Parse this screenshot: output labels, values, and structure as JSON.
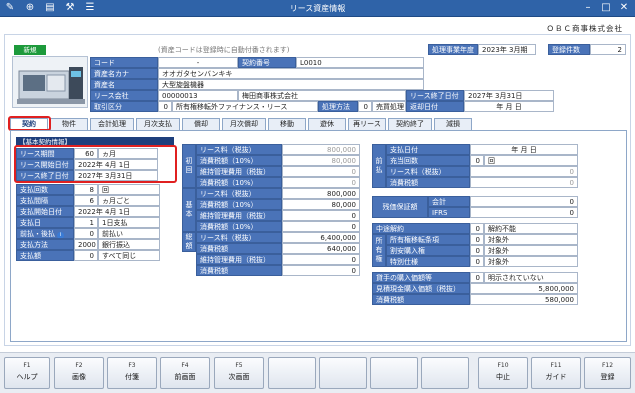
{
  "window": {
    "title": "リース資産情報",
    "company": "ＯＢＣ商事株式会社"
  },
  "header": {
    "new_badge": "新規",
    "code_hint": "(資産コードは登録時に自動付番されます)",
    "fiscal_year_label": "処理事業年度",
    "fiscal_year_value": "2023年 3月期",
    "reg_count_label": "登録件数",
    "reg_count_value": "2",
    "code_label": "コード",
    "code_value": "-",
    "contract_no_label": "契約番号",
    "contract_no_value": "L0010",
    "kana_label": "資産名カナ",
    "kana_value": "オオガタセンバンキキ",
    "name_label": "資産名",
    "name_value": "大型旋盤機器",
    "lease_co_label": "リース会社",
    "lease_co_code": "00000013",
    "lease_co_name": "梅田商事株式会社",
    "lease_end_label": "リース終了日付",
    "lease_end_value": "2027年 3月31日",
    "trade_label": "取引区分",
    "trade_code": "0",
    "trade_name": "所有権移転外ファイナンス・リース",
    "method_label": "処理方法",
    "method_code": "0",
    "method_name": "売買処理",
    "return_label": "返却日付",
    "return_value": "年 月 日"
  },
  "tabs": [
    "契約",
    "物件",
    "会計処理",
    "月次支払",
    "償却",
    "月次償却",
    "移動",
    "遊休",
    "再リース",
    "契約終了",
    "減損"
  ],
  "basic": {
    "title": "【基本契約情報】",
    "period_label": "リース期間",
    "period_value": "60",
    "period_unit": "ヵ月",
    "start_label": "リース開始日付",
    "start_value": "2022年 4月 1日",
    "end_label": "リース終了日付",
    "end_value": "2027年 3月31日"
  },
  "payment": {
    "count_label": "支払回数",
    "count_value": "8",
    "count_unit": "回",
    "interval_label": "支払間隔",
    "interval_value": "6",
    "interval_unit": "ヵ月ごと",
    "start_label": "支払開始日付",
    "start_value": "2022年 4月 1日",
    "day_label": "支払日",
    "day_value": "1",
    "day_unit": "1日支払",
    "prepost_label": "前払・後払",
    "prepost_value": "0",
    "prepost_name": "前払い",
    "method_label": "支払方法",
    "method_value": "2000",
    "method_name": "銀行振込",
    "amount_label": "支払額",
    "amount_value": "0",
    "amount_name": "すべて同じ"
  },
  "initial": {
    "side": "初回",
    "rows": [
      {
        "label": "リース料（税抜）",
        "value": "800,000",
        "dim": true
      },
      {
        "label": "消費税額（10%）",
        "value": "80,000",
        "dim": true
      },
      {
        "label": "維持管理費用（税抜）",
        "value": "0",
        "dim": true
      },
      {
        "label": "消費税額（10%）",
        "value": "0",
        "dim": true
      }
    ]
  },
  "base": {
    "side": "基本",
    "rows": [
      {
        "label": "リース料（税抜）",
        "value": "800,000"
      },
      {
        "label": "消費税額（10%）",
        "value": "80,000"
      },
      {
        "label": "維持管理費用（税抜）",
        "value": "0"
      },
      {
        "label": "消費税額（10%）",
        "value": "0"
      }
    ]
  },
  "total": {
    "side": "総額",
    "rows": [
      {
        "label": "リース料（税抜）",
        "value": "6,400,000"
      },
      {
        "label": "消費税額",
        "value": "640,000"
      },
      {
        "label": "維持管理費用（税抜）",
        "value": "0"
      },
      {
        "label": "消費税額",
        "value": "0"
      }
    ]
  },
  "prepaid": {
    "side": "前払",
    "rows": [
      {
        "label": "支払日付",
        "value": "年 月 日"
      },
      {
        "label": "充当回数",
        "value": "0",
        "unit": "回"
      },
      {
        "label": "リース料（税抜）",
        "value": "0"
      },
      {
        "label": "消費税額",
        "value": "0"
      }
    ]
  },
  "deposit": {
    "label": "残価保証額",
    "rows": [
      {
        "label": "会計",
        "value": "0"
      },
      {
        "label": "IFRS",
        "value": "0"
      }
    ]
  },
  "cancel": {
    "label": "中途解約",
    "code": "0",
    "name": "解約不能"
  },
  "ownership": {
    "side": "所有権",
    "rows": [
      {
        "label": "所有権移転条項",
        "code": "0",
        "name": "対象外"
      },
      {
        "label": "割安購入権",
        "code": "0",
        "name": "対象外"
      },
      {
        "label": "特別仕様",
        "code": "0",
        "name": "対象外"
      }
    ]
  },
  "purchase": {
    "label": "貸手の購入価額等",
    "code": "0",
    "name": "明示されていない",
    "est_label": "見積現金購入価額（税抜）",
    "est_value": "5,800,000",
    "tax_label": "消費税額",
    "tax_value": "580,000"
  },
  "fkeys": [
    {
      "key": "F1",
      "name": "ヘルプ"
    },
    {
      "key": "F2",
      "name": "画像"
    },
    {
      "key": "F3",
      "name": "付箋"
    },
    {
      "key": "F4",
      "name": "前画面"
    },
    {
      "key": "F5",
      "name": "次画面"
    },
    {
      "key": "F10",
      "name": "中止"
    },
    {
      "key": "F11",
      "name": "ガイド"
    },
    {
      "key": "F12",
      "name": "登録"
    }
  ]
}
